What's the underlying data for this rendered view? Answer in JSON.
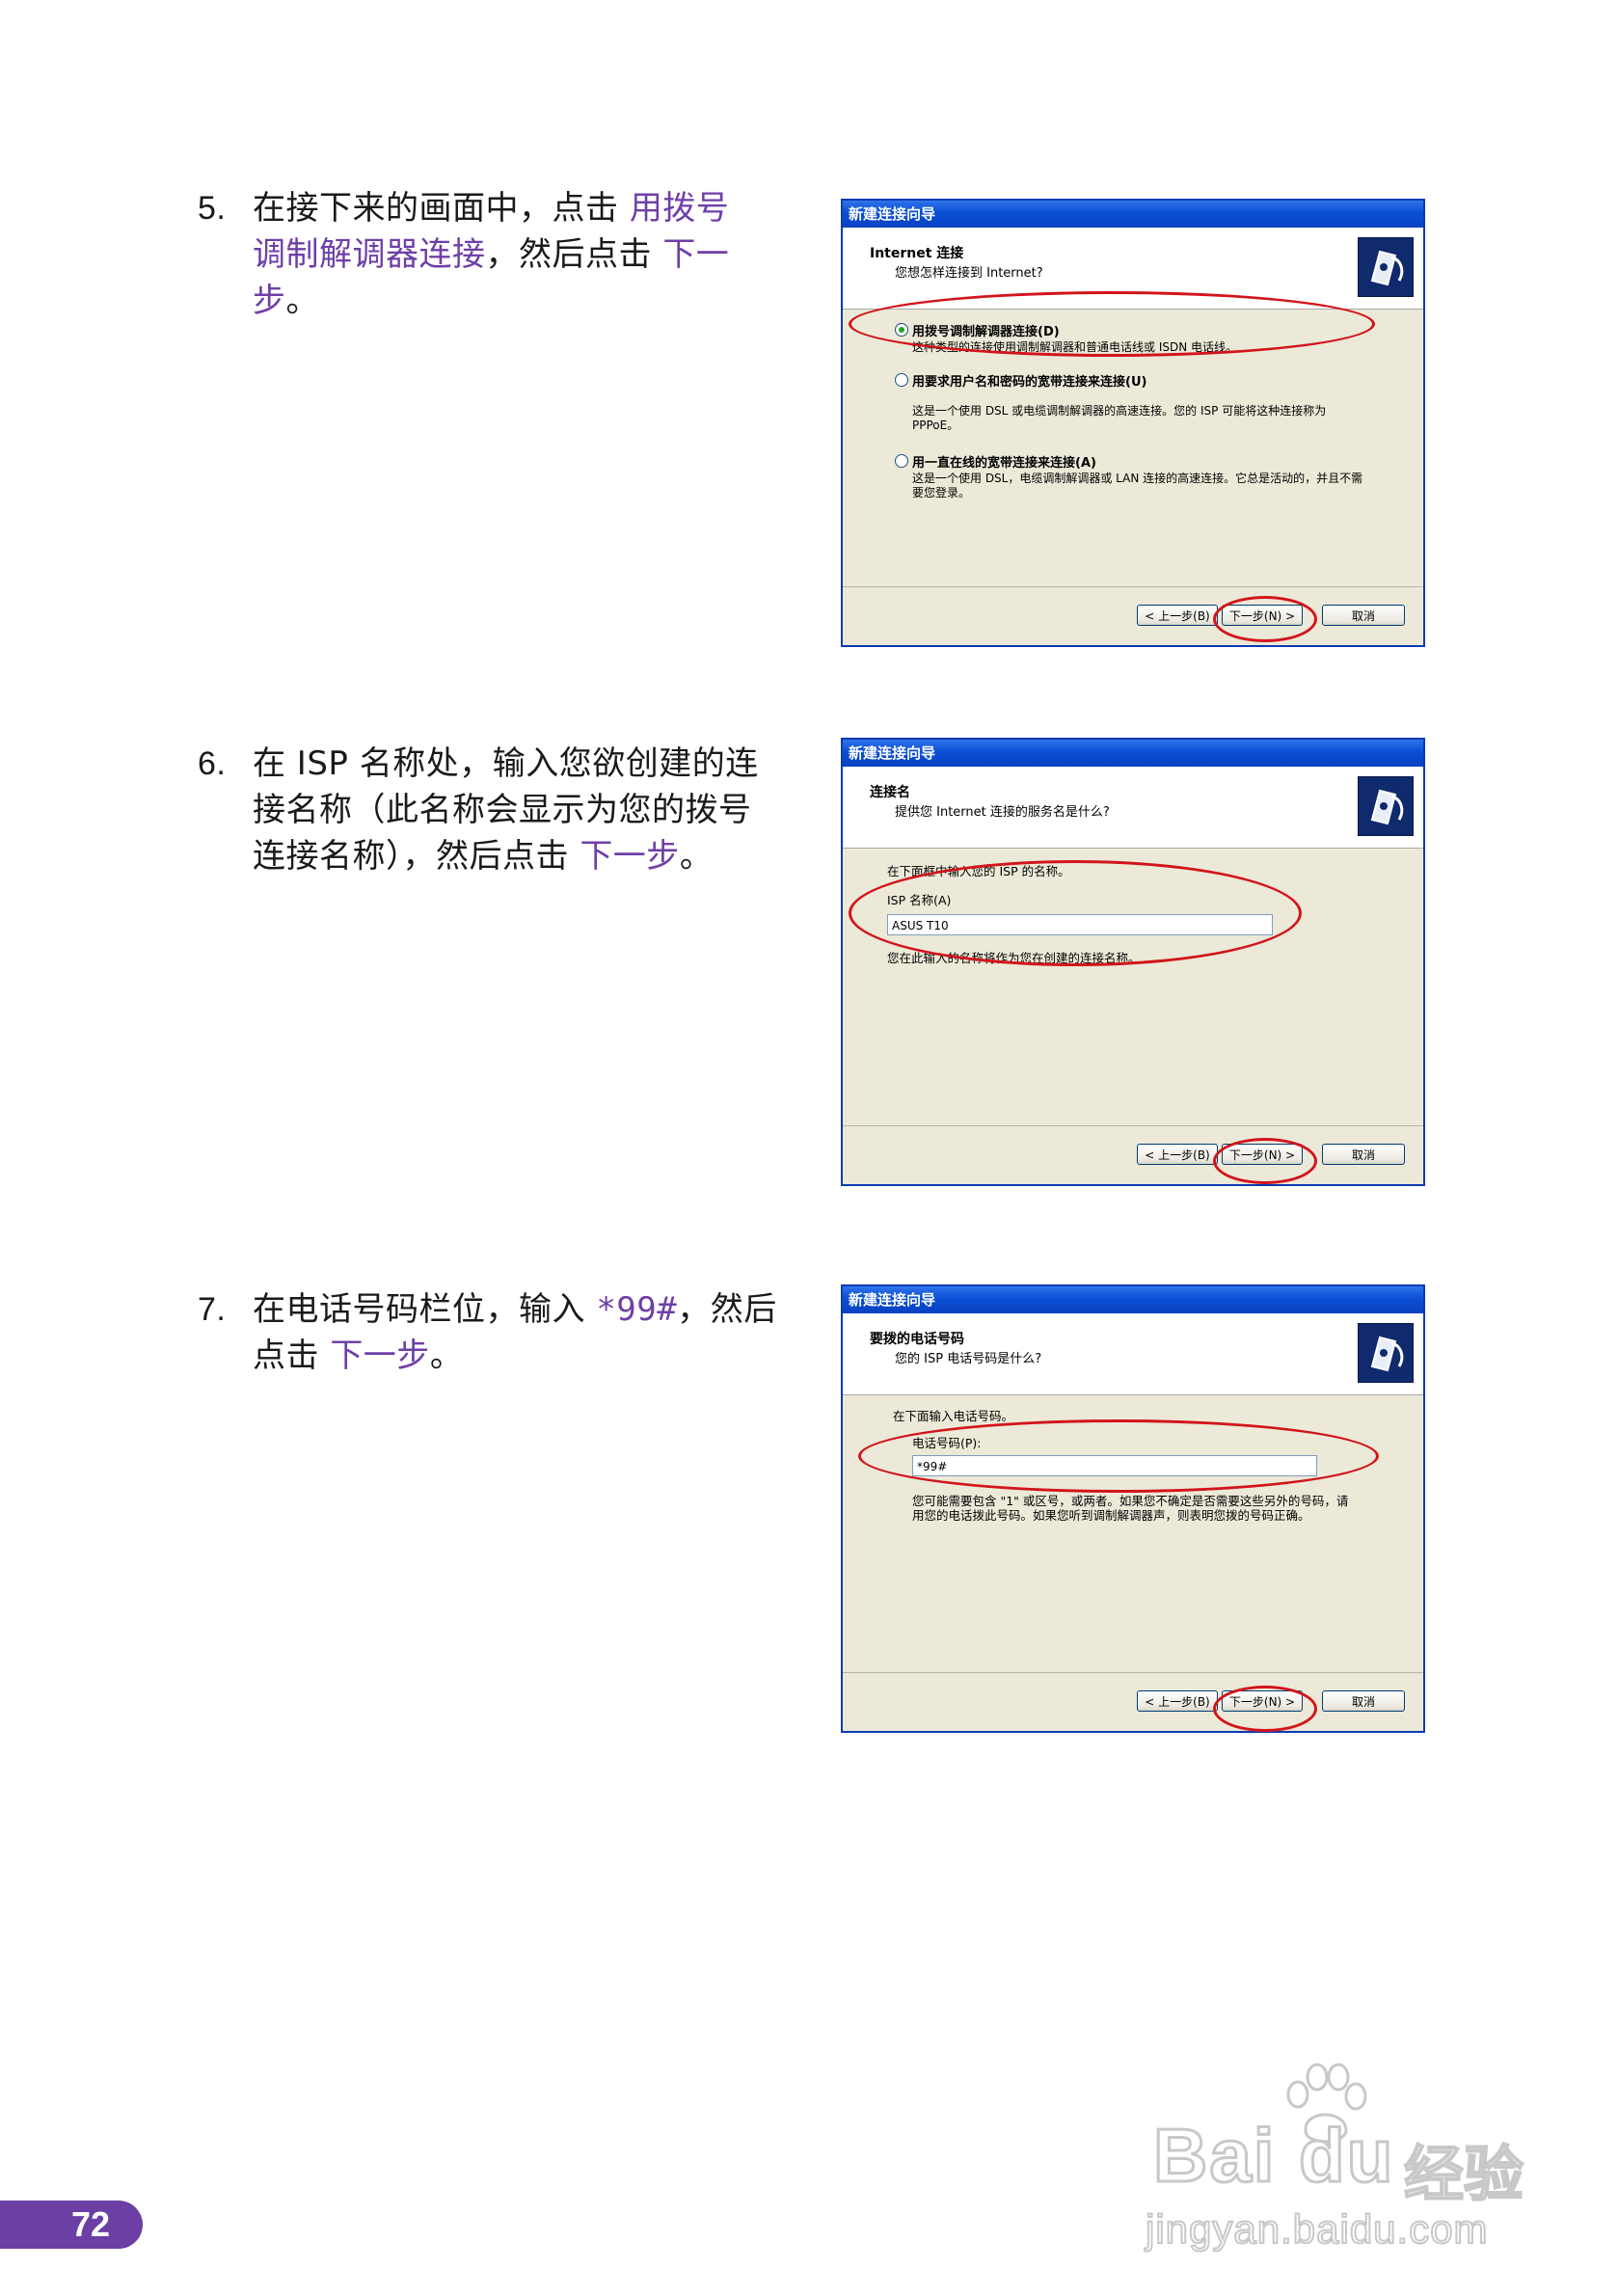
{
  "steps": [
    {
      "number": "5.",
      "line1_pre": "在接下来的画面中，点击 ",
      "line1_hl": "用拨号",
      "line2_hl": "调制解调器连接",
      "line2_post": "，然后点击 ",
      "line2_hl2": "下一",
      "line3_hl": "步",
      "line3_post": "。",
      "dialog": {
        "title": "新建连接向导",
        "header_title": "Internet 连接",
        "header_subtitle": "您想怎样连接到 Internet?",
        "options": [
          {
            "label": "用拨号调制解调器连接(D)",
            "desc": "这种类型的连接使用调制解调器和普通电话线或 ISDN 电话线。",
            "selected": true
          },
          {
            "label": "用要求用户名和密码的宽带连接来连接(U)",
            "desc": "这是一个使用 DSL 或电缆调制解调器的高速连接。您的 ISP 可能将这种连接称为 PPPoE。",
            "selected": false
          },
          {
            "label": "用一直在线的宽带连接来连接(A)",
            "desc": "这是一个使用 DSL，电缆调制解调器或 LAN 连接的高速连接。它总是活动的，并且不需要您登录。",
            "selected": false
          }
        ],
        "back": "< 上一步(B)",
        "next": "下一步(N) >",
        "cancel": "取消"
      }
    },
    {
      "number": "6.",
      "line1": "在 ISP 名称处，输入您欲创建的连",
      "line2": "接名称（此名称会显示为您的拨号",
      "line3_pre": "连接名称），然后点击 ",
      "line3_hl": "下一步",
      "line3_post": "。",
      "dialog": {
        "title": "新建连接向导",
        "header_title": "连接名",
        "header_subtitle": "提供您 Internet 连接的服务名是什么?",
        "prompt": "在下面框中输入您的 ISP 的名称。",
        "field_label": "ISP 名称(A)",
        "field_value": "ASUS T10",
        "hint": "您在此输入的名称将作为您在创建的连接名称。",
        "back": "< 上一步(B)",
        "next": "下一步(N) >",
        "cancel": "取消"
      }
    },
    {
      "number": "7.",
      "line1_pre": "在电话号码栏位，输入 ",
      "line1_hl": "*99#",
      "line1_post": "，然后",
      "line2_pre": "点击 ",
      "line2_hl": "下一步",
      "line2_post": "。",
      "dialog": {
        "title": "新建连接向导",
        "header_title": "要拨的电话号码",
        "header_subtitle": "您的 ISP 电话号码是什么?",
        "prompt": "在下面输入电话号码。",
        "field_label": "电话号码(P):",
        "field_value": "*99#",
        "hint": "您可能需要包含 \"1\" 或区号，或两者。如果您不确定是否需要这些另外的号码，请用您的电话拨此号码。如果您听到调制解调器声，则表明您拨的号码正确。",
        "back": "< 上一步(B)",
        "next": "下一步(N) >",
        "cancel": "取消"
      }
    }
  ],
  "page_number": "72",
  "watermark": {
    "logo": "Bai du",
    "brand_cn": "经验",
    "url": "jingyan.baidu.com"
  },
  "colors": {
    "highlight": "#6e3fa6",
    "annotation": "#d2141b",
    "page_tab": "#6b3fa3"
  }
}
